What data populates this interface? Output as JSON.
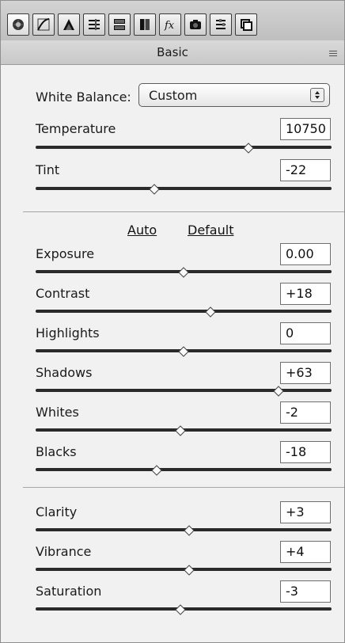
{
  "header": {
    "title": "Basic"
  },
  "tabs": [
    {
      "icon": "camera-lens-icon"
    },
    {
      "icon": "tone-curve-icon"
    },
    {
      "icon": "detail-triangle-icon"
    },
    {
      "icon": "hsl-grayscale-icon"
    },
    {
      "icon": "split-toning-icon"
    },
    {
      "icon": "lens-corrections-icon"
    },
    {
      "icon": "effects-fx-icon"
    },
    {
      "icon": "camera-calibration-icon"
    },
    {
      "icon": "presets-icon"
    },
    {
      "icon": "snapshots-icon"
    }
  ],
  "white_balance": {
    "label": "White Balance:",
    "value": "Custom"
  },
  "sliders": {
    "temperature": {
      "label": "Temperature",
      "value": "10750",
      "position": 0.72
    },
    "tint": {
      "label": "Tint",
      "value": "-22",
      "position": 0.4
    },
    "exposure": {
      "label": "Exposure",
      "value": "0.00",
      "position": 0.5
    },
    "contrast": {
      "label": "Contrast",
      "value": "+18",
      "position": 0.59
    },
    "highlights": {
      "label": "Highlights",
      "value": "0",
      "position": 0.5
    },
    "shadows": {
      "label": "Shadows",
      "value": "+63",
      "position": 0.82
    },
    "whites": {
      "label": "Whites",
      "value": "-2",
      "position": 0.49
    },
    "blacks": {
      "label": "Blacks",
      "value": "-18",
      "position": 0.41
    },
    "clarity": {
      "label": "Clarity",
      "value": "+3",
      "position": 0.52
    },
    "vibrance": {
      "label": "Vibrance",
      "value": "+4",
      "position": 0.52
    },
    "saturation": {
      "label": "Saturation",
      "value": "-3",
      "position": 0.49
    }
  },
  "links": {
    "auto": "Auto",
    "default": "Default"
  }
}
